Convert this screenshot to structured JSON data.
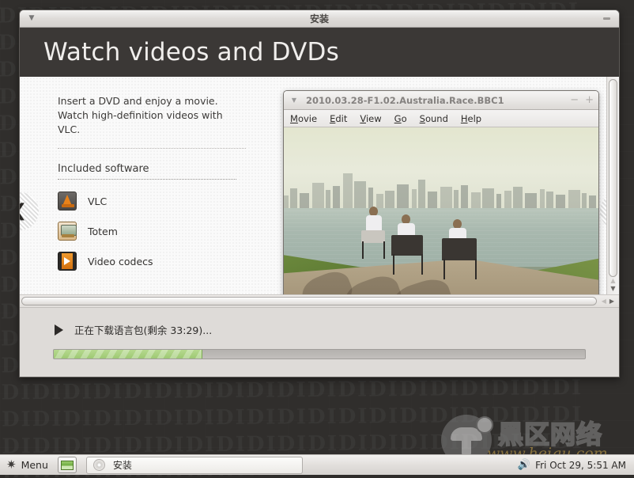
{
  "desktop": {
    "wall_glyph_text": "DIDIDIDIDIDIDIDIDIDIDIDIDIDIDIDIDIDIDI"
  },
  "install_window": {
    "titlebar": {
      "menu_icon": "triangle-down-icon",
      "title": "安装",
      "minimize_label": "—"
    },
    "slide": {
      "heading": "Watch videos and DVDs",
      "description": "Insert a DVD and enjoy a movie. Watch high-definition videos with VLC.",
      "software_heading": "Included software",
      "software": [
        {
          "name": "VLC",
          "icon": "vlc-cone-icon"
        },
        {
          "name": "Totem",
          "icon": "totem-tv-icon"
        },
        {
          "name": "Video codecs",
          "icon": "film-strip-icon"
        }
      ],
      "prev_icon": "chevron-left-icon",
      "next_icon": "chevron-right-icon"
    },
    "movie_window": {
      "menu_icon": "triangle-down-icon",
      "title": "2010.03.28-F1.02.Australia.Race.BBC1",
      "minimize_label": "−",
      "maximize_label": "+",
      "menu_items": [
        {
          "label": "Movie",
          "mnemonic": "M"
        },
        {
          "label": "Edit",
          "mnemonic": "E"
        },
        {
          "label": "View",
          "mnemonic": "V"
        },
        {
          "label": "Go",
          "mnemonic": "G"
        },
        {
          "label": "Sound",
          "mnemonic": "S"
        },
        {
          "label": "Help",
          "mnemonic": "H"
        }
      ],
      "video_alt": "three people seated in folding chairs by a lake facing a city skyline"
    },
    "scrollbars": {
      "vertical_up": "▲",
      "vertical_down": "▼",
      "horizontal_left": "◀",
      "horizontal_right": "▶"
    },
    "progress": {
      "play_icon": "play-triangle-icon",
      "status_text": "正在下载语言包(剩余 33:29)...",
      "percent": 28,
      "bar_color": "#9ec973"
    }
  },
  "watermark": {
    "cn_text": "黑区网络",
    "url_text": "www.heiqu.com",
    "logo_icon": "mushroom-logo-icon"
  },
  "taskbar": {
    "menu_icon": "gear-icon",
    "menu_label": "Menu",
    "show_desktop_icon": "show-desktop-icon",
    "task": {
      "icon": "cd-disc-icon",
      "label": "安装"
    },
    "volume_icon": "speaker-icon",
    "clock": "Fri Oct 29,  5:51 AM"
  }
}
